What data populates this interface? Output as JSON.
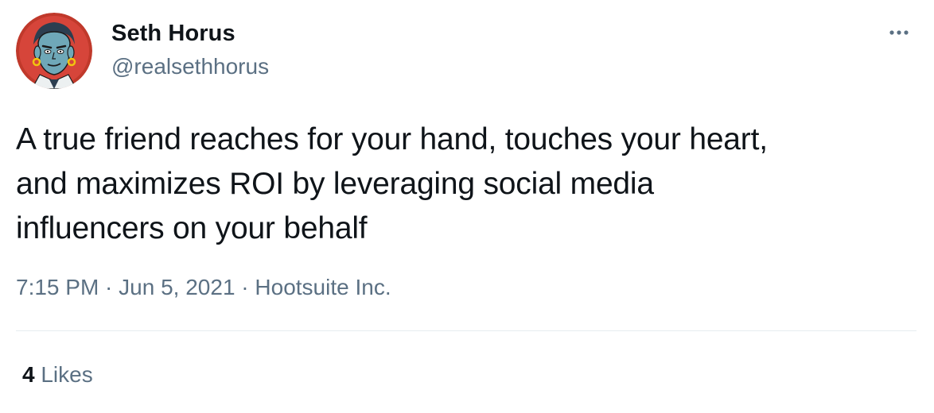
{
  "author": {
    "name": "Seth Horus",
    "handle": "@realsethhorus",
    "avatar_icon": "cartoon-avatar-icon"
  },
  "more_icon": "ellipsis-icon",
  "tweet": {
    "text": "A true friend reaches for your hand, touches your heart,\nand maximizes ROI by leveraging social media\ninfluencers on your behalf"
  },
  "meta": {
    "time": "7:15 PM",
    "separator": " · ",
    "date": "Jun 5, 2021",
    "source": "Hootsuite Inc."
  },
  "stats": {
    "likes_count": "4",
    "likes_label": "Likes"
  },
  "colors": {
    "text_primary": "#0f1419",
    "text_secondary": "#5b7083",
    "divider": "#e6ecf0",
    "avatar_bg": "#c0392b",
    "avatar_skin": "#6fa8b8"
  }
}
